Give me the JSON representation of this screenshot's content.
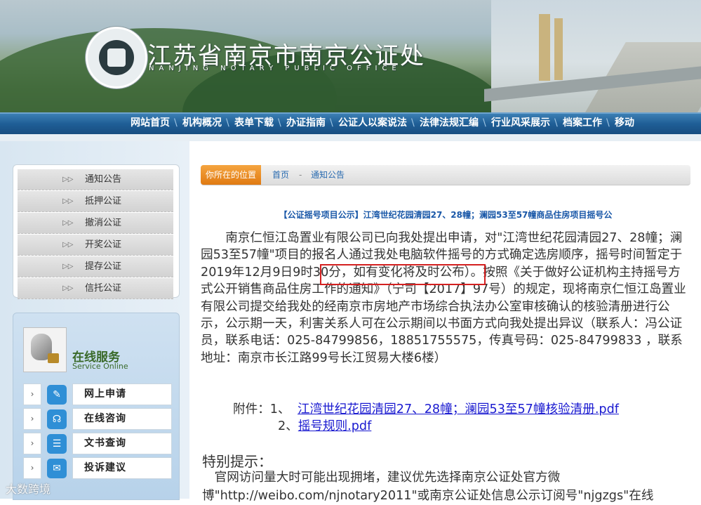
{
  "header": {
    "seal_text": "南京公证处 NANJING NOTARY PUBLIC OFFICE",
    "title": "江苏省南京市南京公证处",
    "subtitle": "NANJING NOTARY PUBLIC OFFICE"
  },
  "nav": {
    "items": [
      "网站首页",
      "机构概况",
      "表单下载",
      "办证指南",
      "公证人以案说法",
      "法律法规汇编",
      "行业风采展示",
      "档案工作",
      "移动"
    ]
  },
  "sidebar": {
    "categories": [
      "通知公告",
      "抵押公证",
      "撤消公证",
      "开奖公证",
      "提存公证",
      "信托公证"
    ],
    "category_arrow": "▷▷",
    "service": {
      "title": "在线服务",
      "title_en": "Service Online",
      "items": [
        {
          "label": "网上申请",
          "icon": "edit-icon"
        },
        {
          "label": "在线咨询",
          "icon": "headset-icon"
        },
        {
          "label": "文书查询",
          "icon": "document-icon"
        },
        {
          "label": "投诉建议",
          "icon": "chat-icon"
        }
      ],
      "chevron": "›"
    }
  },
  "breadcrumb": {
    "tag": "你所在的位置",
    "home": "首页",
    "separator": "-",
    "current": "通知公告"
  },
  "article": {
    "title": "【公证摇号项目公示】江湾世纪花园清园27、28幢；澜园53至57幢商品住房项目摇号公",
    "body": "南京仁恒江岛置业有限公司已向我处提出申请，对\"江湾世纪花园清园27、28幢；澜园53至57幢\"项目的报名人通过我处电脑软件摇号的方式确定选房顺序，摇号时间暂定于2019年12月9日9时30分，如有变化将及时公布）。按照《关于做好公证机构主持摇号方式公开销售商品住房工作的通知》（宁司【2017】97号）的规定，现将南京仁恒江岛置业有限公司提交给我处的经南京市房地产市场综合执法办公室审核确认的核验清册进行公示，公示期一天，利害关系人可在公示期间以书面方式向我处提出异议（联系人：冯公证员，联系电话：025-84799856，18851755575，传真号码：025-84799833 ，联系地址：南京市长江路99号长江贸易大楼6楼）",
    "attachments_label": "附件：",
    "attachments": [
      {
        "index": "1、",
        "name": "江湾世纪花园清园27、28幢；澜园53至57幢核验清册.pdf"
      },
      {
        "index": "2、",
        "name": "摇号规则.pdf"
      }
    ]
  },
  "notice": {
    "title": "特别提示：",
    "body": "官网访问量大时可能出现拥堵，建议优先选择南京公证处官方微博\"http://weibo.com/njnotary2011\"或南京公证处信息公示订阅号\"njgzgs\"在线"
  },
  "watermark": "大数跨境",
  "colors": {
    "nav_blue": "#1f5e96",
    "crumb_orange": "#e07a12",
    "title_blue": "#1a58a8",
    "link_blue": "#1a1ad0",
    "highlight_red": "#d42020"
  }
}
